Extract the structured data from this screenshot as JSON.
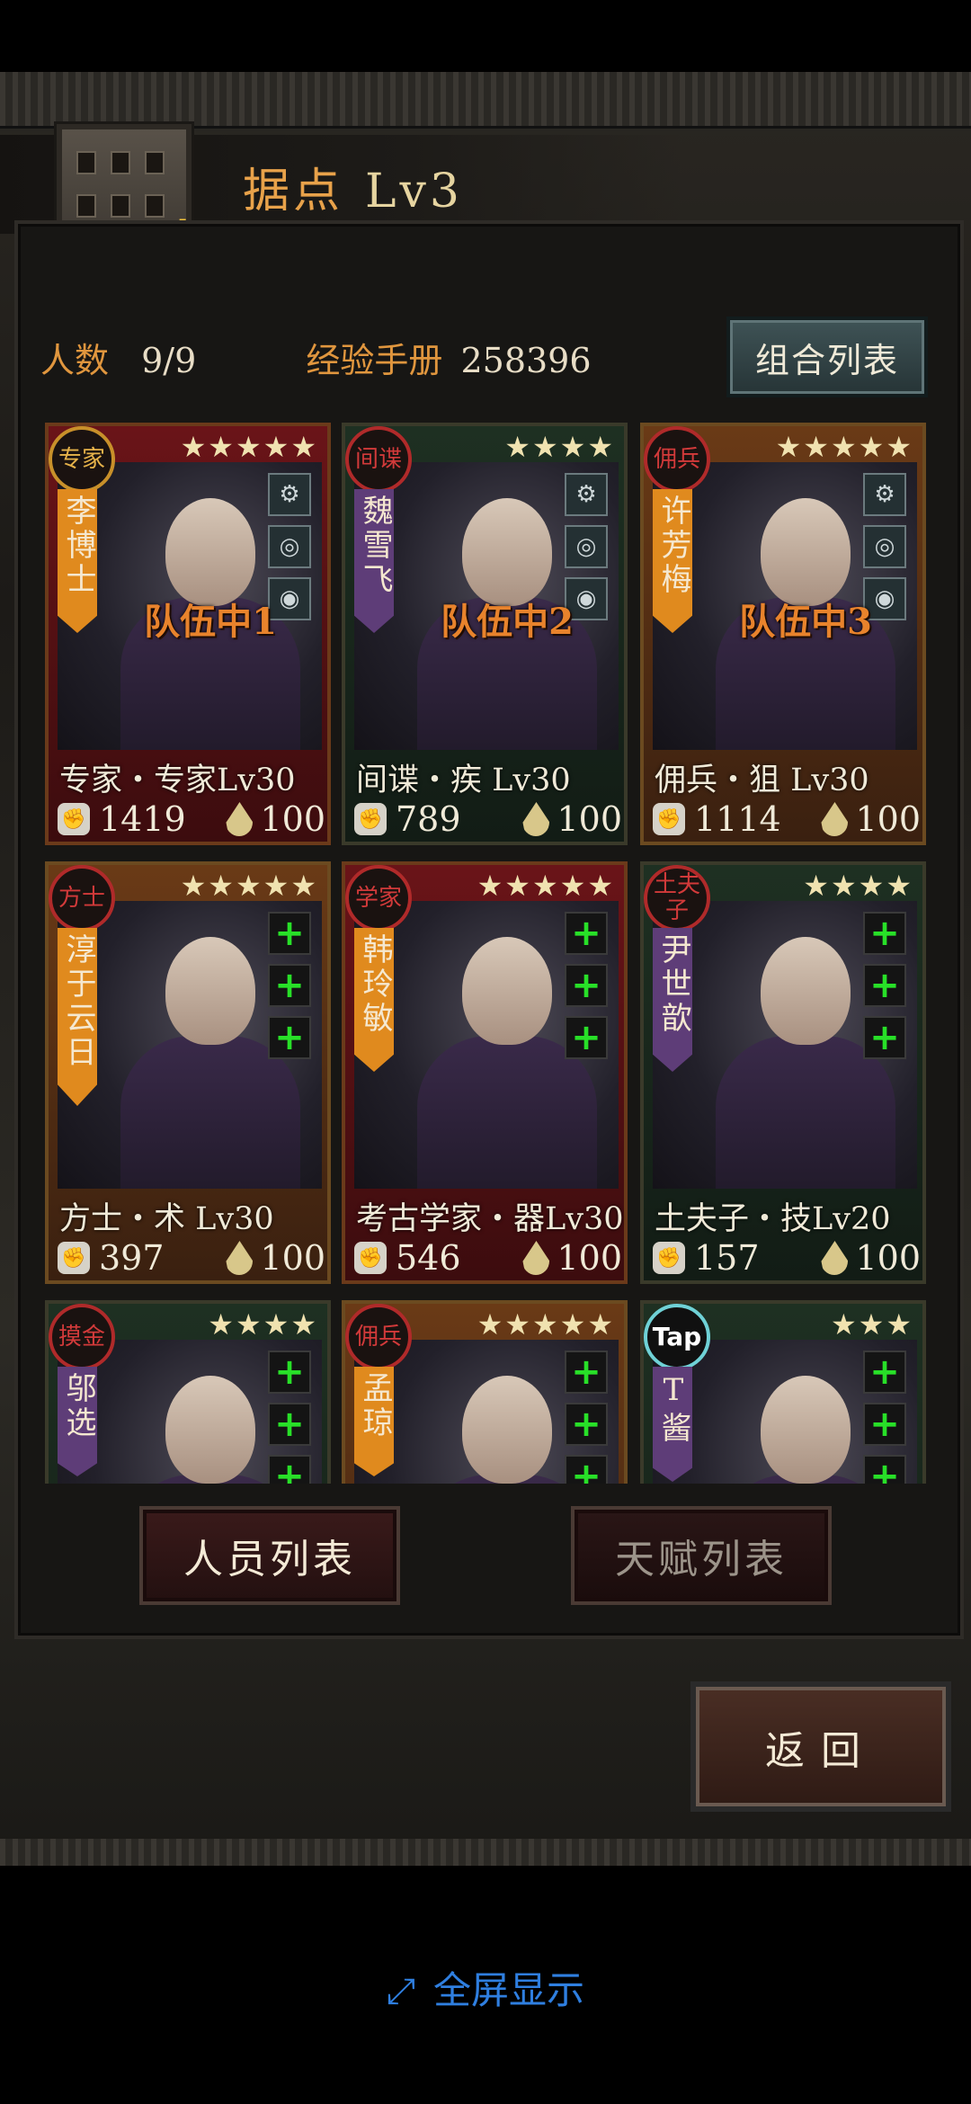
{
  "header": {
    "title": "据点",
    "level": "Lv3"
  },
  "stats": {
    "people_label": "人数",
    "people_value": "9/9",
    "exp_label": "经验手册",
    "exp_value": "258396"
  },
  "combo_button": "组合列表",
  "cards": [
    {
      "badge": "专家",
      "name": "李博士",
      "stars": "★★★★★",
      "team": "队伍中1",
      "class_line": "专家・专家Lv30",
      "power": "1419",
      "energy": "100",
      "theme": "red",
      "banner": "orange",
      "equip": [
        "⚙",
        "◎",
        "◉"
      ]
    },
    {
      "badge": "间谍",
      "name": "魏雪飞",
      "stars": "★★★★",
      "team": "队伍中2",
      "class_line": "间谍・疾 Lv30",
      "power": "789",
      "energy": "100",
      "theme": "green",
      "banner": "purple",
      "equip": [
        "⚙",
        "◎",
        "◉"
      ]
    },
    {
      "badge": "佣兵",
      "name": "许芳梅",
      "stars": "★★★★★",
      "team": "队伍中3",
      "class_line": "佣兵・狙 Lv30",
      "power": "1114",
      "energy": "100",
      "theme": "orange",
      "banner": "orange",
      "equip": [
        "⚙",
        "◎",
        "◉"
      ]
    },
    {
      "badge": "方士",
      "name": "淳于云日",
      "stars": "★★★★★",
      "team": "",
      "class_line": "方士・术 Lv30",
      "power": "397",
      "energy": "100",
      "theme": "orange",
      "banner": "orange",
      "equip": [
        "+",
        "+",
        "+"
      ]
    },
    {
      "badge": "学家",
      "name": "韩玲敏",
      "stars": "★★★★★",
      "team": "",
      "class_line": "考古学家・器Lv30",
      "power": "546",
      "energy": "100",
      "theme": "red",
      "banner": "orange",
      "equip": [
        "+",
        "+",
        "+"
      ]
    },
    {
      "badge": "土夫子",
      "name": "尹世歆",
      "stars": "★★★★",
      "team": "",
      "class_line": "土夫子・技Lv20",
      "power": "157",
      "energy": "100",
      "theme": "green",
      "banner": "purple",
      "equip": [
        "+",
        "+",
        "+"
      ]
    },
    {
      "badge": "摸金",
      "name": "邬选",
      "stars": "★★★★",
      "team": "",
      "class_line": "",
      "power": "",
      "energy": "",
      "theme": "green",
      "banner": "purple",
      "equip": [
        "+",
        "+",
        "+"
      ]
    },
    {
      "badge": "佣兵",
      "name": "孟琼",
      "stars": "★★★★★",
      "team": "",
      "class_line": "",
      "power": "",
      "energy": "",
      "theme": "orange",
      "banner": "orange",
      "equip": [
        "+",
        "+",
        "+"
      ]
    },
    {
      "badge": "Tap",
      "name": "T酱",
      "stars": "★★★",
      "team": "",
      "class_line": "",
      "power": "",
      "energy": "",
      "theme": "green",
      "banner": "purple",
      "equip": [
        "+",
        "+",
        "+"
      ]
    }
  ],
  "buttons": {
    "staff_list": "人员列表",
    "talent_list": "天赋列表",
    "back": "返回"
  },
  "footer": {
    "fullscreen": "全屏显示"
  },
  "colors": {
    "accent_orange": "#e0963e",
    "plus_green": "#28e028",
    "link_blue": "#2f7fe0"
  }
}
